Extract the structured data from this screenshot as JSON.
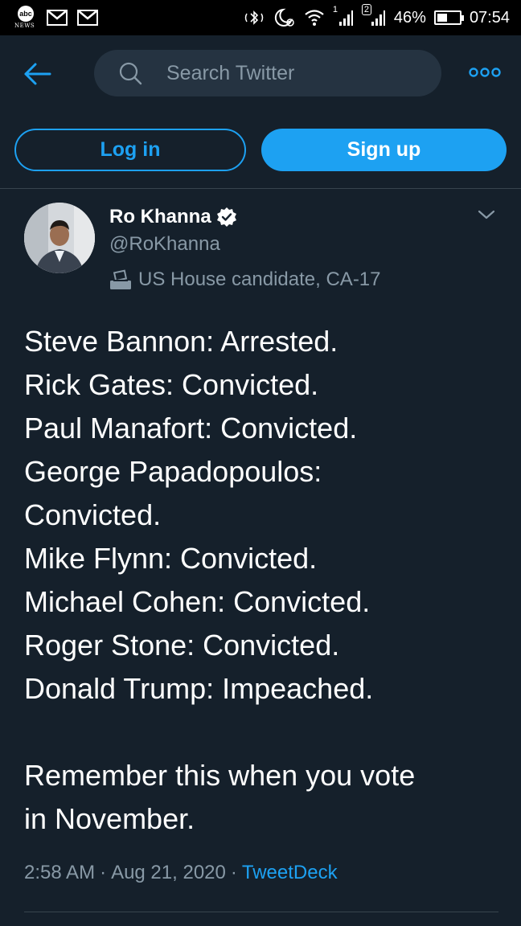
{
  "status_bar": {
    "abc_logo_text": "abc",
    "abc_news_text": "NEWS",
    "sim1_label": "1",
    "sim2_label": "2",
    "battery_percent": "46%",
    "battery_level": 0.46,
    "time": "07:54"
  },
  "nav": {
    "search_placeholder": "Search Twitter"
  },
  "auth": {
    "login_label": "Log in",
    "signup_label": "Sign up"
  },
  "tweet": {
    "author_name": "Ro Khanna",
    "author_handle": "@RoKhanna",
    "label": "US House candidate, CA-17",
    "text": "Steve Bannon: Arrested.\nRick Gates: Convicted.\nPaul Manafort: Convicted.\nGeorge Papadopoulos:\nConvicted.\nMike Flynn: Convicted.\nMichael Cohen: Convicted.\nRoger Stone: Convicted.\nDonald Trump: Impeached.\n\nRemember this when you vote\nin November.",
    "time": "2:58 AM",
    "separator": "·",
    "date": "Aug 21, 2020",
    "source": "TweetDeck"
  },
  "colors": {
    "background": "#15202b",
    "accent": "#1da1f2",
    "secondary_text": "#8899a6",
    "search_bg": "#253341",
    "divider": "#38444d"
  },
  "icons": {
    "back": "arrow-left-icon",
    "search": "search-icon",
    "more": "more-horizontal-icon",
    "verified": "verified-badge-icon",
    "caret": "chevron-down-icon",
    "ballot": "ballot-box-icon"
  }
}
